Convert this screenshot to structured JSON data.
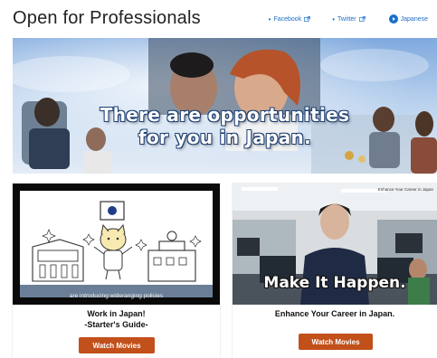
{
  "header": {
    "title": "Open for Professionals",
    "links": [
      {
        "label": "Facebook"
      },
      {
        "label": "Twitter"
      }
    ],
    "language": "Japanese"
  },
  "hero": {
    "line1": "There are opportunities",
    "line2": "for you in Japan."
  },
  "cards": [
    {
      "title_line1": "Work in Japan!",
      "title_line2": "-Starter's Guide-",
      "image_caption": "are introducing wideranging policies",
      "button": "Watch Movies"
    },
    {
      "title": "Enhance Your Career in Japan.",
      "image_caption": "Make It Happen.",
      "image_corner": "Enhance Your Career in Japan",
      "button": "Watch Movies"
    }
  ],
  "colors": {
    "link": "#1a6fc9",
    "button": "#c2501a",
    "hero_text_outline": "#1d3f73"
  }
}
